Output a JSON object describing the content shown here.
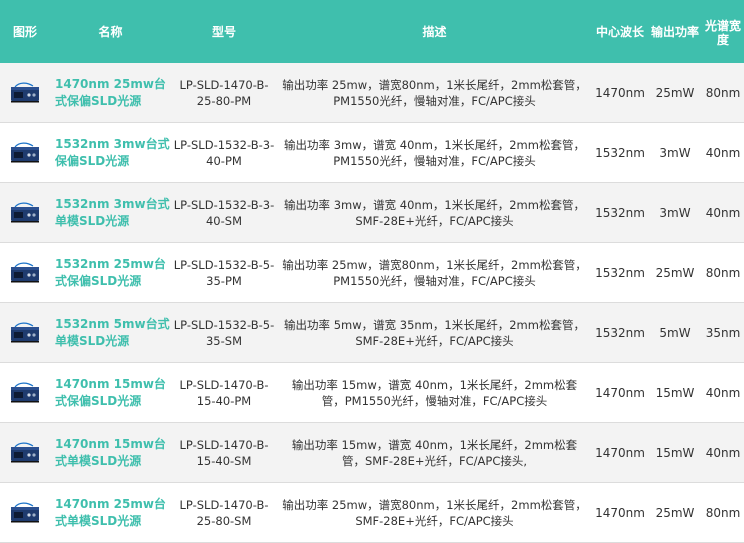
{
  "header": {
    "image": "图形",
    "name": "名称",
    "model": "型号",
    "description": "描述",
    "wavelength": "中心波长",
    "power": "输出功率",
    "bandwidth": "光谱宽度"
  },
  "rows": [
    {
      "name": "1470nm 25mw台式保偏SLD光源",
      "model": "LP-SLD-1470-B-25-80-PM",
      "desc": "输出功率 25mw，谱宽80nm，1米长尾纤，2mm松套管，PM1550光纤，慢轴对准，FC/APC接头",
      "wavelength": "1470nm",
      "power": "25mW",
      "bandwidth": "80nm",
      "icon": "sld-device-icon"
    },
    {
      "name": "1532nm 3mw台式保偏SLD光源",
      "model": "LP-SLD-1532-B-3-40-PM",
      "desc": "输出功率 3mw，谱宽 40nm，1米长尾纤，2mm松套管，PM1550光纤，慢轴对准，FC/APC接头",
      "wavelength": "1532nm",
      "power": "3mW",
      "bandwidth": "40nm",
      "icon": "sld-device-icon"
    },
    {
      "name": "1532nm 3mw台式单模SLD光源",
      "model": "LP-SLD-1532-B-3-40-SM",
      "desc": "输出功率 3mw，谱宽 40nm，1米长尾纤，2mm松套管，SMF-28E+光纤，FC/APC接头",
      "wavelength": "1532nm",
      "power": "3mW",
      "bandwidth": "40nm",
      "icon": "sld-device-icon"
    },
    {
      "name": "1532nm 25mw台式保偏SLD光源",
      "model": "LP-SLD-1532-B-5-35-PM",
      "desc": "输出功率 25mw，谱宽80nm，1米长尾纤，2mm松套管，PM1550光纤，慢轴对准，FC/APC接头",
      "wavelength": "1532nm",
      "power": "25mW",
      "bandwidth": "80nm",
      "icon": "sld-device-icon"
    },
    {
      "name": "1532nm 5mw台式单模SLD光源",
      "model": "LP-SLD-1532-B-5-35-SM",
      "desc": "输出功率 5mw，谱宽 35nm，1米长尾纤，2mm松套管，SMF-28E+光纤，FC/APC接头",
      "wavelength": "1532nm",
      "power": "5mW",
      "bandwidth": "35nm",
      "icon": "sld-device-icon"
    },
    {
      "name": "1470nm 15mw台式保偏SLD光源",
      "model": "LP-SLD-1470-B-15-40-PM",
      "desc": "输出功率 15mw，谱宽 40nm，1米长尾纤，2mm松套管，PM1550光纤，慢轴对准，FC/APC接头",
      "wavelength": "1470nm",
      "power": "15mW",
      "bandwidth": "40nm",
      "icon": "sld-device-icon"
    },
    {
      "name": "1470nm 15mw台式单模SLD光源",
      "model": "LP-SLD-1470-B-15-40-SM",
      "desc": "输出功率 15mw，谱宽 40nm，1米长尾纤，2mm松套管，SMF-28E+光纤，FC/APC接头,",
      "wavelength": "1470nm",
      "power": "15mW",
      "bandwidth": "40nm",
      "icon": "sld-device-icon"
    },
    {
      "name": "1470nm 25mw台式单模SLD光源",
      "model": "LP-SLD-1470-B-25-80-SM",
      "desc": "输出功率 25mw，谱宽80nm，1米长尾纤，2mm松套管，SMF-28E+光纤，FC/APC接头",
      "wavelength": "1470nm",
      "power": "25mW",
      "bandwidth": "80nm",
      "icon": "sld-device-icon"
    }
  ],
  "colors": {
    "header_bg": "#3fbfad",
    "link": "#3fbfad",
    "row_alt": "#f3f3f3"
  }
}
